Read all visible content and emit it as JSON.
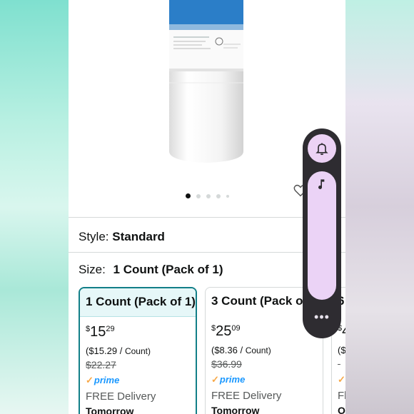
{
  "product": {
    "image_dots": 5,
    "active_dot": 0
  },
  "style": {
    "label": "Style:",
    "value": "Standard"
  },
  "size": {
    "label": "Size:",
    "value": "1 Count (Pack of 1)"
  },
  "options": [
    {
      "title": "1 Count (Pack of 1)",
      "currency": "$",
      "price_whole": "15",
      "price_cents": "29",
      "unit_price_prefix": "($15.29 / ",
      "unit_price_unit": "Count)",
      "was_price": "$22.27",
      "prime": "prime",
      "delivery": "FREE Delivery",
      "delivery_day": "Tomorrow",
      "selected": true
    },
    {
      "title": "3 Count (Pack of 3)",
      "currency": "$",
      "price_whole": "25",
      "price_cents": "09",
      "unit_price_prefix": "($8.36 / ",
      "unit_price_unit": "Count)",
      "was_price": "$36.99",
      "prime": "prime",
      "delivery": "FREE Delivery",
      "delivery_day": "Tomorrow",
      "selected": false
    },
    {
      "title": "6",
      "currency": "$",
      "price_whole": "4",
      "price_cents": "",
      "unit_price_prefix": "($",
      "unit_price_unit": "",
      "was_price": "",
      "prime": "",
      "delivery": "Fl",
      "delivery_day": "O",
      "selected": false
    }
  ],
  "float_panel": {
    "more_label": "•••"
  },
  "colors": {
    "selected_border": "#127f88",
    "selected_header_bg": "#e6f7f8",
    "prime_blue": "#1a98ff",
    "panel_bg": "#2e2c31",
    "panel_accent": "#ecd2f5"
  }
}
